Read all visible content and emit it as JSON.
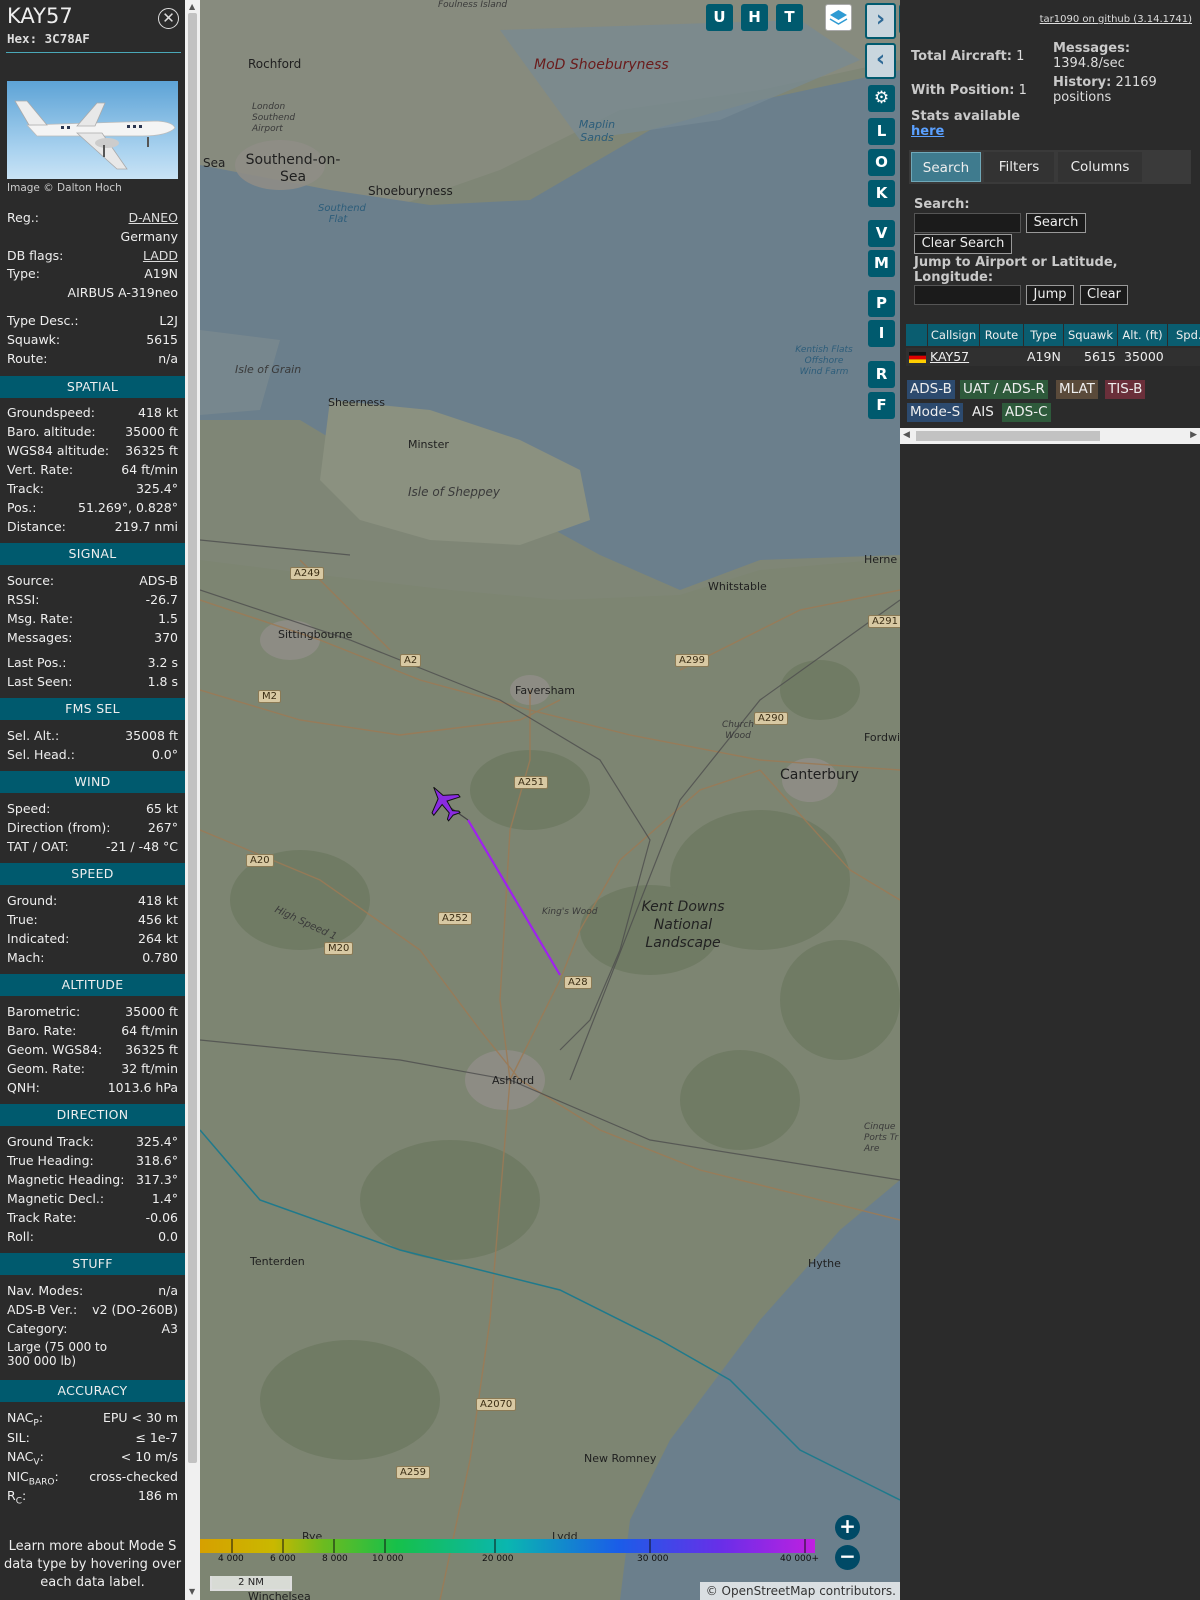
{
  "aircraft": {
    "callsign": "KAY57",
    "hex_label": "Hex:",
    "hex": "3C78AF",
    "photo_credit": "Image © Dalton Hoch"
  },
  "identity": [
    {
      "k": "Reg.:",
      "v": "D-ANEO",
      "link": true
    },
    {
      "k": "",
      "v": "Germany"
    },
    {
      "k": "DB flags:",
      "v": "LADD",
      "link": true
    },
    {
      "k": "Type:",
      "v": "A19N"
    },
    {
      "k": "",
      "v": "AIRBUS A-319neo"
    },
    {
      "k": "Type Desc.:",
      "v": "L2J"
    },
    {
      "k": "Squawk:",
      "v": "5615"
    },
    {
      "k": "Route:",
      "v": "n/a"
    }
  ],
  "sections": {
    "spatial": "SPATIAL",
    "signal": "SIGNAL",
    "fms": "FMS SEL",
    "wind": "WIND",
    "speed": "SPEED",
    "altitude": "ALTITUDE",
    "direction": "DIRECTION",
    "stuff": "STUFF",
    "accuracy": "ACCURACY"
  },
  "spatial": [
    {
      "k": "Groundspeed:",
      "v": "418 kt"
    },
    {
      "k": "Baro. altitude:",
      "v": "35000 ft"
    },
    {
      "k": "WGS84 altitude:",
      "v": "36325 ft"
    },
    {
      "k": "Vert. Rate:",
      "v": "64 ft/min"
    },
    {
      "k": "Track:",
      "v": "325.4°"
    },
    {
      "k": "Pos.:",
      "v": "51.269°, 0.828°"
    },
    {
      "k": "Distance:",
      "v": "219.7 nmi"
    }
  ],
  "signal": [
    {
      "k": "Source:",
      "v": "ADS-B"
    },
    {
      "k": "RSSI:",
      "v": "-26.7"
    },
    {
      "k": "Msg. Rate:",
      "v": "1.5"
    },
    {
      "k": "Messages:",
      "v": "370"
    },
    {
      "k": "Last Pos.:",
      "v": "3.2 s"
    },
    {
      "k": "Last Seen:",
      "v": "1.8 s"
    }
  ],
  "fms": [
    {
      "k": "Sel. Alt.:",
      "v": "35008 ft"
    },
    {
      "k": "Sel. Head.:",
      "v": "0.0°"
    }
  ],
  "wind": [
    {
      "k": "Speed:",
      "v": "65 kt"
    },
    {
      "k": "Direction (from):",
      "v": "267°"
    },
    {
      "k": "TAT / OAT:",
      "v": "-21 / -48 °C"
    }
  ],
  "speed": [
    {
      "k": "Ground:",
      "v": "418 kt"
    },
    {
      "k": "True:",
      "v": "456 kt"
    },
    {
      "k": "Indicated:",
      "v": "264 kt"
    },
    {
      "k": "Mach:",
      "v": "0.780"
    }
  ],
  "altitude": [
    {
      "k": "Barometric:",
      "v": "35000 ft"
    },
    {
      "k": "Baro. Rate:",
      "v": "64 ft/min"
    },
    {
      "k": "Geom. WGS84:",
      "v": "36325 ft"
    },
    {
      "k": "Geom. Rate:",
      "v": "32 ft/min"
    },
    {
      "k": "QNH:",
      "v": "1013.6 hPa"
    }
  ],
  "direction": [
    {
      "k": "Ground Track:",
      "v": "325.4°"
    },
    {
      "k": "True Heading:",
      "v": "318.6°"
    },
    {
      "k": "Magnetic Heading:",
      "v": "317.3°"
    },
    {
      "k": "Magnetic Decl.:",
      "v": "1.4°"
    },
    {
      "k": "Track Rate:",
      "v": "-0.06"
    },
    {
      "k": "Roll:",
      "v": "0.0"
    }
  ],
  "stuff": [
    {
      "k": "Nav. Modes:",
      "v": "n/a"
    },
    {
      "k": "ADS-B Ver.:",
      "v": "v2 (DO-260B)"
    },
    {
      "k": "Category:",
      "v": "A3"
    }
  ],
  "category_desc": "Large (75 000 to 300 000 lb)",
  "accuracy": [
    {
      "k": "NAC",
      "sub": "P",
      "tail": ":",
      "v": "EPU < 30 m"
    },
    {
      "k": "SIL:",
      "sub": "",
      "tail": "",
      "v": "≤ 1e-7"
    },
    {
      "k": "NAC",
      "sub": "V",
      "tail": ":",
      "v": "< 10 m/s"
    },
    {
      "k": "NIC",
      "sub": "BARO",
      "tail": ":",
      "v": "cross-checked"
    },
    {
      "k": "R",
      "sub": "C",
      "tail": ":",
      "v": "186 m"
    }
  ],
  "learn_more": "Learn more about Mode S data type by hovering over each data label.",
  "map": {
    "buttons_top": [
      "U",
      "H",
      "T"
    ],
    "buttons_side": [
      "L",
      "O",
      "K",
      "V",
      "M",
      "P",
      "I",
      "R",
      "F"
    ],
    "places": [
      {
        "t": "Rochford"
      },
      {
        "t": "London Southend Airport"
      },
      {
        "t": "Southend-on-Sea"
      },
      {
        "t": "Shoeburyness"
      },
      {
        "t": "MoD Shoeburyness"
      },
      {
        "t": "Maplin Sands"
      },
      {
        "t": "Southend Flat"
      },
      {
        "t": "Sea"
      },
      {
        "t": "Isle of Grain"
      },
      {
        "t": "Sheerness"
      },
      {
        "t": "Minster"
      },
      {
        "t": "Isle of Sheppey"
      },
      {
        "t": "Kentish Flats Offshore Wind Farm"
      },
      {
        "t": "Herne"
      },
      {
        "t": "Whitstable"
      },
      {
        "t": "Sittingbourne"
      },
      {
        "t": "Faversham"
      },
      {
        "t": "Church Wood"
      },
      {
        "t": "Fordwich"
      },
      {
        "t": "Canterbury"
      },
      {
        "t": "King's Wood"
      },
      {
        "t": "Kent Downs National Landscape"
      },
      {
        "t": "Ashford"
      },
      {
        "t": "High Speed 1"
      },
      {
        "t": "Tenterden"
      },
      {
        "t": "Hythe"
      },
      {
        "t": "New Romney"
      },
      {
        "t": "Rye"
      },
      {
        "t": "Lydd"
      },
      {
        "t": "Winchelsea"
      },
      {
        "t": "Cinque Ports Tr Are"
      },
      {
        "t": "Foulness Island"
      }
    ],
    "roads": [
      "A249",
      "A2",
      "M2",
      "A299",
      "A290",
      "A291",
      "A251",
      "A20",
      "A252",
      "M20",
      "A28",
      "A2070",
      "A259"
    ],
    "altitude_legend": [
      "4 000",
      "6 000",
      "8 000",
      "10 000",
      "20 000",
      "30 000",
      "40 000+"
    ],
    "scale": "2 NM",
    "attribution": "© OpenStreetMap contributors."
  },
  "stats": {
    "total_label": "Total Aircraft:",
    "total": "1",
    "with_pos_label": "With Position:",
    "with_pos": "1",
    "stats_label": "Stats available",
    "stats_link": "here",
    "messages_label": "Messages:",
    "messages": "1394.8/sec",
    "history_label": "History:",
    "history": "21169 positions",
    "github": "tar1090 on github (3.14.1741)"
  },
  "tabs": {
    "search": "Search",
    "filters": "Filters",
    "columns": "Columns"
  },
  "search": {
    "label": "Search:",
    "button": "Search",
    "clear": "Clear Search",
    "jump_label": "Jump to Airport or Latitude, Longitude:",
    "jump": "Jump",
    "jump_clear": "Clear"
  },
  "table": {
    "headers": [
      "",
      "Callsign",
      "Route",
      "Type",
      "Squawk",
      "Alt. (ft)",
      "Spd."
    ],
    "row": {
      "callsign": "KAY57",
      "route": "",
      "type": "A19N",
      "squawk": "5615",
      "alt": "35000"
    }
  },
  "sources": [
    {
      "label": "ADS-B",
      "color": "#2c4a6e"
    },
    {
      "label": "UAT / ADS-R",
      "color": "#2e5a3b"
    },
    {
      "label": "MLAT",
      "color": "#5a4a3a"
    },
    {
      "label": "TIS-B",
      "color": "#6a2f3a"
    },
    {
      "label": "Mode-S",
      "color": "#2c4a6e"
    },
    {
      "label": "AIS",
      "color": "#2b2b2b"
    },
    {
      "label": "ADS-C",
      "color": "#2e5a3b"
    }
  ],
  "colors": {
    "accent": "#005a6e",
    "track": "#a020f0",
    "aircraft": "#8a2be2"
  }
}
